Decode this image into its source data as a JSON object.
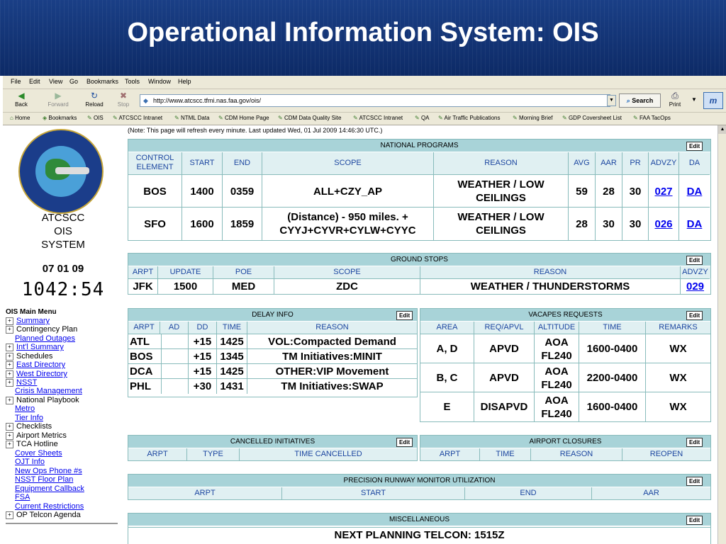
{
  "banner": {
    "title": "Operational Information System:  OIS"
  },
  "menubar": {
    "items": [
      "File",
      "Edit",
      "View",
      "Go",
      "Bookmarks",
      "Tools",
      "Window",
      "Help"
    ]
  },
  "toolbar": {
    "back": "Back",
    "forward": "Forward",
    "reload": "Reload",
    "stop": "Stop",
    "url": "http://www.atcscc.tfmi.nas.faa.gov/ois/",
    "search": "Search",
    "print": "Print"
  },
  "bookmarks": [
    "Home",
    "Bookmarks",
    "OIS",
    "ATCSCC Intranet",
    "NTML Data",
    "CDM Home Page",
    "CDM Data Quality Site",
    "ATCSCC Intranet",
    "QA",
    "Air Traffic Publications",
    "Morning Brief",
    "GDP Coversheet List",
    "FAA TacOps"
  ],
  "sidebar": {
    "system_lines": [
      "ATCSCC",
      "OIS",
      "SYSTEM"
    ],
    "date": "07 01 09",
    "time": "1042:54",
    "menu_heading": "OIS Main Menu",
    "items": [
      {
        "label": "Summary",
        "type": "pm-link"
      },
      {
        "label": "Contingency Plan",
        "type": "pm-text"
      },
      {
        "label": "Planned Outages",
        "type": "link"
      },
      {
        "label": "Int'l Summary",
        "type": "pm-link"
      },
      {
        "label": "Schedules",
        "type": "pm-text"
      },
      {
        "label": "East Directory",
        "type": "pm-link"
      },
      {
        "label": "West Directory",
        "type": "pm-link"
      },
      {
        "label": "NSST",
        "type": "pm-link"
      },
      {
        "label": "Crisis Management",
        "type": "link"
      },
      {
        "label": "National Playbook",
        "type": "pm-text"
      },
      {
        "label": "Metro",
        "type": "link"
      },
      {
        "label": "Tier Info",
        "type": "link"
      },
      {
        "label": "Checklists",
        "type": "pm-text"
      },
      {
        "label": "Airport Metrics",
        "type": "pm-text"
      },
      {
        "label": "TCA Hotline",
        "type": "pm-text"
      },
      {
        "label": "Cover Sheets",
        "type": "link"
      },
      {
        "label": "OJT Info",
        "type": "link"
      },
      {
        "label": "New Ops Phone #s",
        "type": "link"
      },
      {
        "label": "NSST Floor Plan",
        "type": "link"
      },
      {
        "label": "Equipment Callback",
        "type": "link"
      },
      {
        "label": "FSA",
        "type": "link"
      },
      {
        "label": "Current Restrictions",
        "type": "link"
      },
      {
        "label": "OP Telcon Agenda",
        "type": "pm-text"
      }
    ]
  },
  "note": "(Note: This page will refresh every minute.  Last updated Wed, 01 Jul 2009 14:46:30 UTC.)",
  "edit_label": "Edit",
  "national_programs": {
    "title": "NATIONAL PROGRAMS",
    "headers": [
      "CONTROL ELEMENT",
      "START",
      "END",
      "SCOPE",
      "REASON",
      "AVG",
      "AAR",
      "PR",
      "ADVZY",
      "DA"
    ],
    "rows": [
      [
        "BOS",
        "1400",
        "0359",
        "ALL+CZY_AP",
        "WEATHER / LOW CEILINGS",
        "59",
        "28",
        "30",
        "027",
        "DA"
      ],
      [
        "SFO",
        "1600",
        "1859",
        "(Distance) - 950 miles. + CYYJ+CYVR+CYLW+CYYC",
        "WEATHER / LOW CEILINGS",
        "28",
        "30",
        "30",
        "026",
        "DA"
      ]
    ]
  },
  "ground_stops": {
    "title": "GROUND STOPS",
    "headers": [
      "ARPT",
      "UPDATE",
      "POE",
      "SCOPE",
      "REASON",
      "ADVZY"
    ],
    "rows": [
      [
        "JFK",
        "1500",
        "MED",
        "ZDC",
        "WEATHER / THUNDERSTORMS",
        "029"
      ]
    ]
  },
  "delay_info": {
    "title": "DELAY INFO",
    "headers": [
      "ARPT",
      "AD",
      "DD",
      "TIME",
      "REASON"
    ],
    "rows": [
      [
        "ATL",
        "",
        "+15",
        "1425",
        "VOL:Compacted Demand"
      ],
      [
        "BOS",
        "",
        "+15",
        "1345",
        "TM Initiatives:MINIT"
      ],
      [
        "DCA",
        "",
        "+15",
        "1425",
        "OTHER:VIP Movement"
      ],
      [
        "PHL",
        "",
        "+30",
        "1431",
        "TM Initiatives:SWAP"
      ]
    ]
  },
  "vacapes": {
    "title": "VACAPES REQUESTS",
    "headers": [
      "AREA",
      "REQ/APVL",
      "ALTITUDE",
      "TIME",
      "REMARKS"
    ],
    "rows": [
      [
        "A, D",
        "APVD",
        "AOA FL240",
        "1600-0400",
        "WX"
      ],
      [
        "B, C",
        "APVD",
        "AOA FL240",
        "2200-0400",
        "WX"
      ],
      [
        "E",
        "DISAPVD",
        "AOA FL240",
        "1600-0400",
        "WX"
      ]
    ]
  },
  "cancelled": {
    "title": "CANCELLED INITIATIVES",
    "headers": [
      "ARPT",
      "TYPE",
      "TIME CANCELLED"
    ]
  },
  "closures": {
    "title": "AIRPORT CLOSURES",
    "headers": [
      "ARPT",
      "TIME",
      "REASON",
      "REOPEN"
    ]
  },
  "prm": {
    "title": "PRECISION RUNWAY MONITOR UTILIZATION",
    "headers": [
      "ARPT",
      "START",
      "END",
      "AAR"
    ]
  },
  "misc": {
    "title": "MISCELLANEOUS",
    "text": "NEXT PLANNING TELCON: 1515Z"
  }
}
